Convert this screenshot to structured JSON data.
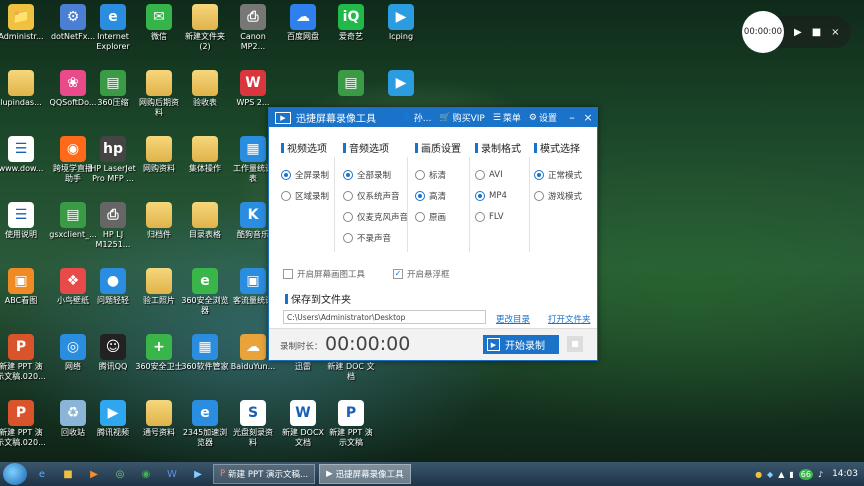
{
  "desktop_icons": [
    {
      "label": "Administr...",
      "glyph": "📁",
      "color": "#f0c040",
      "col": 0,
      "row": 0
    },
    {
      "label": "dotNetFx...",
      "glyph": "⚙",
      "color": "#4a7fd4",
      "col": 1,
      "row": 0
    },
    {
      "label": "Internet\nExplorer",
      "glyph": "e",
      "color": "#2a8de0",
      "col": 2,
      "row": 0
    },
    {
      "label": "微信",
      "glyph": "✉",
      "color": "#35b44a",
      "col": 3,
      "row": 0
    },
    {
      "label": "新建文件夹\n(2)",
      "glyph": "",
      "color": "#f0c040",
      "col": 4,
      "row": 0
    },
    {
      "label": "Canon\nMP2...",
      "glyph": "⎙",
      "color": "#777777",
      "col": 5,
      "row": 0
    },
    {
      "label": "百度网盘",
      "glyph": "☁",
      "color": "#2f80ed",
      "col": 6,
      "row": 0
    },
    {
      "label": "爱奇艺",
      "glyph": "iQ",
      "color": "#21b94a",
      "col": 7,
      "row": 0
    },
    {
      "label": "lcping",
      "glyph": "▶",
      "color": "#2c9ce0",
      "col": 8,
      "row": 0
    },
    {
      "label": "lupindas...",
      "glyph": "",
      "color": "#f0c040",
      "col": 0,
      "row": 1
    },
    {
      "label": "QQSoftDo...",
      "glyph": "❀",
      "color": "#e84a8a",
      "col": 1,
      "row": 1
    },
    {
      "label": "360压缩",
      "glyph": "▤",
      "color": "#3a9a45",
      "col": 2,
      "row": 1
    },
    {
      "label": "网购后期资\n料",
      "glyph": "",
      "color": "#f0c040",
      "col": 3,
      "row": 1
    },
    {
      "label": "验收表",
      "glyph": "",
      "color": "#f0c040",
      "col": 4,
      "row": 1
    },
    {
      "label": "WPS 2...",
      "glyph": "W",
      "color": "#d9363e",
      "col": 5,
      "row": 1
    },
    {
      "label": "",
      "glyph": "▤",
      "color": "#3a9a45",
      "col": 7,
      "row": 1
    },
    {
      "label": "",
      "glyph": "▶",
      "color": "#2c9ce0",
      "col": 8,
      "row": 1
    },
    {
      "label": "www.dow...",
      "glyph": "☰",
      "color": "#ffffff",
      "col": 0,
      "row": 2
    },
    {
      "label": "跨境学直播\n助手",
      "glyph": "◉",
      "color": "#ff6a1a",
      "col": 1,
      "row": 2
    },
    {
      "label": "HP LaserJet\nPro MFP ...",
      "glyph": "hp",
      "color": "#444444",
      "col": 2,
      "row": 2
    },
    {
      "label": "网购资料",
      "glyph": "",
      "color": "#f0c040",
      "col": 3,
      "row": 2
    },
    {
      "label": "集体操作",
      "glyph": "",
      "color": "#f0c040",
      "col": 4,
      "row": 2
    },
    {
      "label": "工作量统计\n表",
      "glyph": "▦",
      "color": "#2a8de0",
      "col": 5,
      "row": 2
    },
    {
      "label": "使用说明",
      "glyph": "☰",
      "color": "#ffffff",
      "col": 0,
      "row": 3
    },
    {
      "label": "gsxclient_...",
      "glyph": "▤",
      "color": "#3a9a45",
      "col": 1,
      "row": 3
    },
    {
      "label": "HP LJ\nM1251...",
      "glyph": "⎙",
      "color": "#666666",
      "col": 2,
      "row": 3
    },
    {
      "label": "归档件",
      "glyph": "",
      "color": "#f0c040",
      "col": 3,
      "row": 3
    },
    {
      "label": "目录表格",
      "glyph": "",
      "color": "#f0c040",
      "col": 4,
      "row": 3
    },
    {
      "label": "酷狗音乐",
      "glyph": "K",
      "color": "#2a8de0",
      "col": 5,
      "row": 3
    },
    {
      "label": "ABC看图",
      "glyph": "▣",
      "color": "#f08a24",
      "col": 0,
      "row": 4
    },
    {
      "label": "小鸟壁纸",
      "glyph": "❖",
      "color": "#e84a4a",
      "col": 1,
      "row": 4
    },
    {
      "label": "问题轻轻",
      "glyph": "●",
      "color": "#2a8de0",
      "col": 2,
      "row": 4
    },
    {
      "label": "验工照片",
      "glyph": "",
      "color": "#f0c040",
      "col": 3,
      "row": 4
    },
    {
      "label": "360安全浏览\n器",
      "glyph": "e",
      "color": "#3ab54a",
      "col": 4,
      "row": 4
    },
    {
      "label": "客流量统计",
      "glyph": "▣",
      "color": "#2a8de0",
      "col": 5,
      "row": 4
    },
    {
      "label": "新建 PPT 演\n示文稿.020...",
      "glyph": "P",
      "color": "#d9532b",
      "col": 0,
      "row": 5
    },
    {
      "label": "网络",
      "glyph": "◎",
      "color": "#2a8de0",
      "col": 1,
      "row": 5
    },
    {
      "label": "腾讯QQ",
      "glyph": "☺",
      "color": "#222222",
      "col": 2,
      "row": 5
    },
    {
      "label": "360安全卫士",
      "glyph": "+",
      "color": "#3ab54a",
      "col": 3,
      "row": 5
    },
    {
      "label": "360软件管家",
      "glyph": "▦",
      "color": "#2a8de0",
      "col": 4,
      "row": 5
    },
    {
      "label": "BaiduYun...",
      "glyph": "☁",
      "color": "#e8a33a",
      "col": 5,
      "row": 5
    },
    {
      "label": "迅雷",
      "glyph": "➤",
      "color": "#2a8de0",
      "col": 6,
      "row": 5
    },
    {
      "label": "新建 DOC 文\n档",
      "glyph": "W",
      "color": "#ffffff",
      "col": 7,
      "row": 5
    },
    {
      "label": "新建 PPT 演\n示文稿.020...",
      "glyph": "P",
      "color": "#d9532b",
      "col": 0,
      "row": 6
    },
    {
      "label": "回收站",
      "glyph": "♻",
      "color": "#8ab4d8",
      "col": 1,
      "row": 6
    },
    {
      "label": "腾讯视频",
      "glyph": "▶",
      "color": "#2fa7ef",
      "col": 2,
      "row": 6
    },
    {
      "label": "通号资料",
      "glyph": "",
      "color": "#f0c040",
      "col": 3,
      "row": 6
    },
    {
      "label": "2345加速浏\n览器",
      "glyph": "e",
      "color": "#2a8de0",
      "col": 4,
      "row": 6
    },
    {
      "label": "光盘刻录资\n料",
      "glyph": "S",
      "color": "#ffffff",
      "col": 5,
      "row": 6
    },
    {
      "label": "新建 DOCX\n文档",
      "glyph": "W",
      "color": "#ffffff",
      "col": 6,
      "row": 6
    },
    {
      "label": "新建 PPT 演\n示文稿",
      "glyph": "P",
      "color": "#ffffff",
      "col": 7,
      "row": 6
    }
  ],
  "recorder": {
    "title": "迅捷屏幕录像工具",
    "user": "孙...",
    "vip": "购买VIP",
    "menu": "菜单",
    "settings": "设置",
    "video": {
      "head": "视频选项",
      "options": [
        "全屏录制",
        "区域录制"
      ],
      "selected": 0
    },
    "audio": {
      "head": "音频选项",
      "options": [
        "全部录制",
        "仅系统声音",
        "仅麦克风声音",
        "不录声音"
      ],
      "selected": 0
    },
    "quality": {
      "head": "画质设置",
      "options": [
        "标清",
        "高清",
        "原画"
      ],
      "selected": 1
    },
    "format": {
      "head": "录制格式",
      "options": [
        "AVI",
        "MP4",
        "FLV"
      ],
      "selected": 1
    },
    "mode": {
      "head": "模式选择",
      "options": [
        "正常模式",
        "游戏模式"
      ],
      "selected": 0
    },
    "check_tools": "开启屏幕画图工具",
    "check_float": "开启悬浮框",
    "save_head": "保存到文件夹",
    "save_path": "C:\\Users\\Administrator\\Desktop",
    "change_dir": "更改目录",
    "open_folder": "打开文件夹",
    "duration_label": "录制时长：",
    "duration": "00:00:00",
    "start_label": "开始录制"
  },
  "mini_bar": {
    "time": "00:00:00"
  },
  "taskbar": {
    "tasks": [
      "新建 PPT 演示文稿...",
      "迅捷屏幕录像工具"
    ],
    "clock": "14:03",
    "tray_badge": "66"
  }
}
